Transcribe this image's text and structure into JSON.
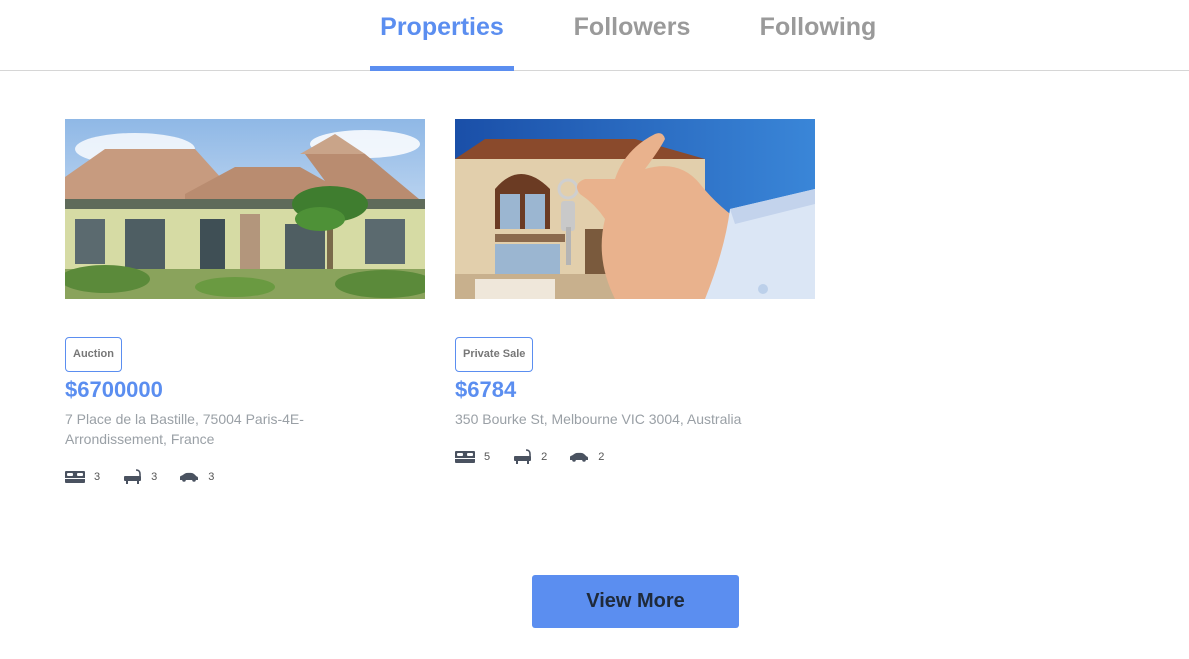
{
  "tabs": [
    {
      "label": "Properties",
      "active": true
    },
    {
      "label": "Followers",
      "active": false
    },
    {
      "label": "Following",
      "active": false
    }
  ],
  "colors": {
    "accent": "#5b8ef0",
    "tab_inactive": "#9a9a9a",
    "muted_text": "#9aa0a6",
    "divider": "#d6d6d6"
  },
  "properties": [
    {
      "image": "house-with-tiled-roof-and-palm-trees",
      "sale_type": "Auction",
      "price": "$6700000",
      "address": "7 Place de la Bastille, 75004 Paris-4E-Arrondissement, France",
      "features": {
        "beds": "3",
        "baths": "3",
        "cars": "3"
      }
    },
    {
      "image": "hand-holding-house-keys",
      "sale_type": "Private Sale",
      "price": "$6784",
      "address": "350 Bourke St, Melbourne VIC 3004, Australia",
      "features": {
        "beds": "5",
        "baths": "2",
        "cars": "2"
      }
    }
  ],
  "icons": {
    "beds": "bed-icon",
    "baths": "bathtub-icon",
    "cars": "car-icon"
  },
  "view_more_label": "View More"
}
